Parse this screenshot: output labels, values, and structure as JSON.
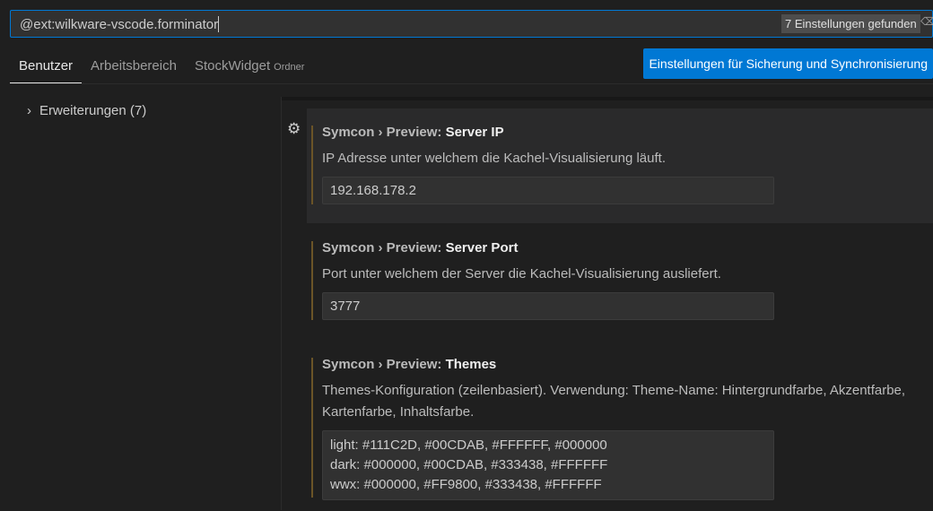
{
  "search": {
    "query": "@ext:wilkware-vscode.forminator",
    "result_count": "7 Einstellungen gefunden",
    "clear_icon": "clear-filter-icon"
  },
  "tabs": [
    {
      "label": "Benutzer",
      "active": true
    },
    {
      "label": "Arbeitsbereich"
    },
    {
      "label": "StockWidget",
      "suffix": "Ordner"
    }
  ],
  "sync_button": "Einstellungen für Sicherung und Synchronisierung",
  "toc": {
    "item": "Erweiterungen (7)"
  },
  "settings": [
    {
      "prefix": "Symcon › Preview: ",
      "name": "Server IP",
      "description": "IP Adresse unter welchem die Kachel-Visualisierung läuft.",
      "value": "192.168.178.2"
    },
    {
      "prefix": "Symcon › Preview: ",
      "name": "Server Port",
      "description": "Port unter welchem der Server die Kachel-Visualisierung ausliefert.",
      "value": "3777"
    },
    {
      "prefix": "Symcon › Preview: ",
      "name": "Themes",
      "description": "Themes-Konfiguration (zeilenbasiert). Verwendung: Theme-Name: Hintergrundfarbe, Akzentfarbe, Kartenfarbe, Inhaltsfarbe.",
      "lines": [
        "light: #111C2D, #00CDAB, #FFFFFF, #000000",
        "dark: #000000, #00CDAB, #333438, #FFFFFF",
        "wwx: #000000, #FF9800, #333438, #FFFFFF"
      ]
    }
  ],
  "colors": {
    "accent": "#0078d4",
    "modified_indicator": "#6b5427",
    "background": "#1f1f1f"
  }
}
